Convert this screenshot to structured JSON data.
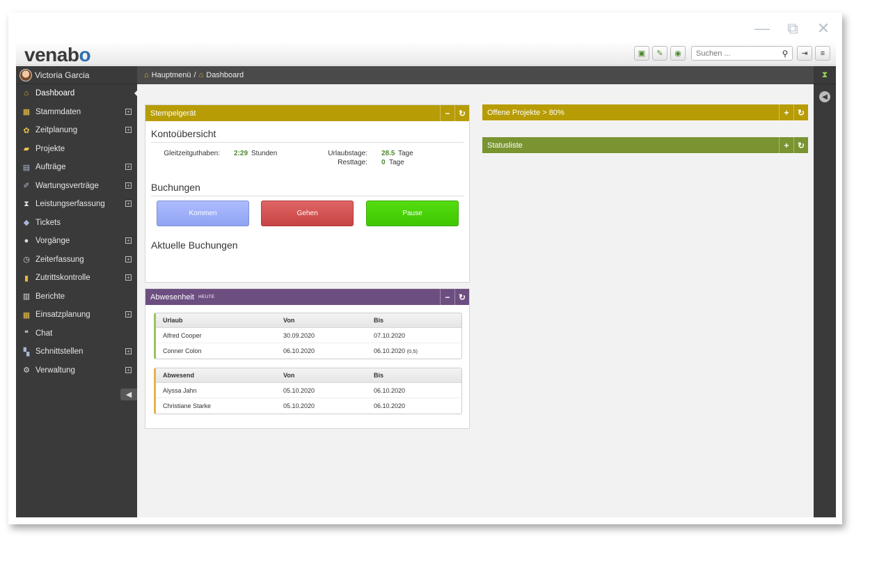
{
  "app": {
    "logo": "venabo"
  },
  "header": {
    "search_placeholder": "Suchen ..."
  },
  "user": {
    "name": "Victoria Garcia"
  },
  "sidebar": {
    "items": [
      {
        "label": "Dashboard",
        "icon": "home-icon",
        "expandable": false
      },
      {
        "label": "Stammdaten",
        "icon": "folder-icon",
        "expandable": true
      },
      {
        "label": "Zeitplanung",
        "icon": "calendar-icon",
        "expandable": true
      },
      {
        "label": "Projekte",
        "icon": "project-icon",
        "expandable": false
      },
      {
        "label": "Aufträge",
        "icon": "orders-icon",
        "expandable": true
      },
      {
        "label": "Wartungsverträge",
        "icon": "wrench-icon",
        "expandable": true
      },
      {
        "label": "Leistungserfassung",
        "icon": "hourglass-icon",
        "expandable": true
      },
      {
        "label": "Tickets",
        "icon": "ticket-icon",
        "expandable": false
      },
      {
        "label": "Vorgänge",
        "icon": "database-icon",
        "expandable": true
      },
      {
        "label": "Zeiterfassung",
        "icon": "clock-icon",
        "expandable": true
      },
      {
        "label": "Zutrittskontrolle",
        "icon": "door-icon",
        "expandable": true
      },
      {
        "label": "Berichte",
        "icon": "report-icon",
        "expandable": false
      },
      {
        "label": "Einsatzplanung",
        "icon": "planning-icon",
        "expandable": true
      },
      {
        "label": "Chat",
        "icon": "chat-icon",
        "expandable": false
      },
      {
        "label": "Schnittstellen",
        "icon": "interface-icon",
        "expandable": true
      },
      {
        "label": "Verwaltung",
        "icon": "gear-icon",
        "expandable": true
      }
    ]
  },
  "breadcrumb": {
    "root": "Hauptmenü",
    "separator": "/",
    "current": "Dashboard"
  },
  "stempel": {
    "title": "Stempelgerät",
    "konto_title": "Kontoübersicht",
    "gleitzeit_label": "Gleitzeitguthaben:",
    "gleitzeit_value": "2:29",
    "gleitzeit_unit": "Stunden",
    "urlaub_label": "Urlaubstage:",
    "urlaub_value": "28.5",
    "urlaub_unit": "Tage",
    "rest_label": "Resttage:",
    "rest_value": "0",
    "rest_unit": "Tage",
    "buchungen_title": "Buchungen",
    "btn_kommen": "Kommen",
    "btn_gehen": "Gehen",
    "btn_pause": "Pause",
    "aktuelle_title": "Aktuelle Buchungen"
  },
  "abwesenheit": {
    "title": "Abwesenheit",
    "badge": "HEUTE",
    "urlaub_table": {
      "headers": [
        "Urlaub",
        "Von",
        "Bis"
      ],
      "rows": [
        {
          "name": "Alfred Cooper",
          "von": "30.09.2020",
          "bis": "07.10.2020",
          "note": ""
        },
        {
          "name": "Conner Colon",
          "von": "06.10.2020",
          "bis": "06.10.2020",
          "note": "(0,5)"
        }
      ]
    },
    "abwesend_table": {
      "headers": [
        "Abwesend",
        "Von",
        "Bis"
      ],
      "rows": [
        {
          "name": "Alyssa Jahn",
          "von": "05.10.2020",
          "bis": "06.10.2020",
          "note": ""
        },
        {
          "name": "Christiane Starke",
          "von": "05.10.2020",
          "bis": "06.10.2020",
          "note": ""
        }
      ]
    }
  },
  "projekte_panel": {
    "title": "Offene Projekte > 80%"
  },
  "status_panel": {
    "title": "Statusliste"
  },
  "colors": {
    "sidebar_bg": "#3a3a3a",
    "gold_header": "#b79c05",
    "olive_header": "#799431",
    "purple_header": "#6d4e80",
    "value_green": "#4c8a2e"
  }
}
